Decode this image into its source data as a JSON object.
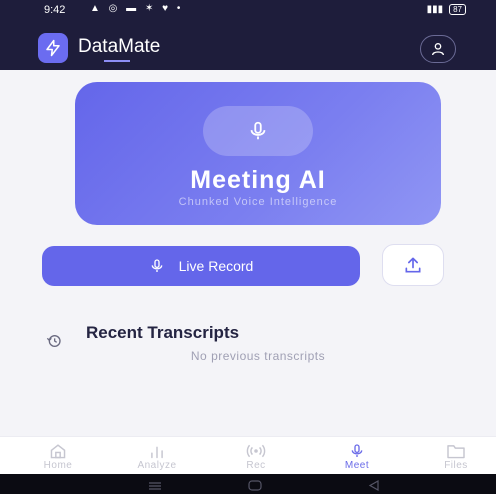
{
  "status_bar": {
    "time": "9:42",
    "battery": "87"
  },
  "header": {
    "app_title": "DataMate"
  },
  "hero": {
    "title": "Meeting AI",
    "subtitle": "Chunked Voice Intelligence"
  },
  "actions": {
    "record_label": "Live Record"
  },
  "recent": {
    "title": "Recent Transcripts",
    "empty_message": "No previous transcripts"
  },
  "nav": {
    "items": [
      {
        "label": "Home",
        "icon": "home-icon"
      },
      {
        "label": "Analyze",
        "icon": "bar-chart-icon"
      },
      {
        "label": "Rec",
        "icon": "broadcast-icon"
      },
      {
        "label": "Meet",
        "icon": "microphone-icon",
        "active": true
      },
      {
        "label": "Files",
        "icon": "folder-icon"
      }
    ]
  },
  "colors": {
    "header_bg": "#1e1d3b",
    "accent": "#6466ea",
    "active_nav": "#6a6be8"
  }
}
